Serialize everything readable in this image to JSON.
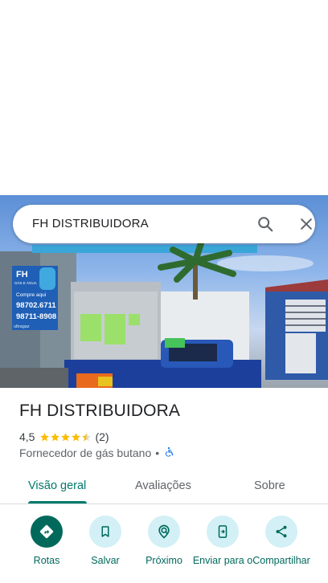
{
  "search": {
    "query": "FH DISTRIBUIDORA"
  },
  "photo_sign": {
    "brand": "FH",
    "line1": "GÁS E ÁGUA",
    "line2": "Compre aqui",
    "phone1": "98702.6711",
    "phone2": "98711-8908",
    "footer": "ultragaz"
  },
  "place": {
    "title": "FH DISTRIBUIDORA",
    "rating": "4,5",
    "stars": 4.5,
    "review_count": "(2)",
    "category": "Fornecedor de gás butano",
    "separator": "•"
  },
  "tabs": [
    {
      "label": "Visão geral",
      "active": true
    },
    {
      "label": "Avaliações"
    },
    {
      "label": "Sobre"
    }
  ],
  "actions": [
    {
      "label": "Rotas",
      "icon": "directions-icon"
    },
    {
      "label": "Salvar",
      "icon": "bookmark-icon"
    },
    {
      "label": "Próximo",
      "icon": "nearby-icon"
    },
    {
      "label": "Enviar para o",
      "icon": "send-to-phone-icon"
    },
    {
      "label": "Compartilhar",
      "icon": "share-icon"
    }
  ],
  "colors": {
    "accent": "#00796b",
    "action_bg": "#d2f0f5",
    "star": "#fbbc04"
  }
}
